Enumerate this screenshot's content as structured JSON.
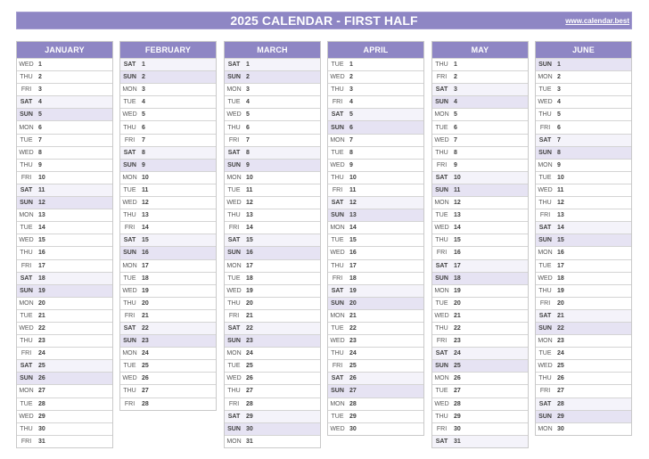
{
  "title": "2025 CALENDAR - FIRST HALF",
  "site_link": "www.calendar.best",
  "colors": {
    "header": "#8e86c4",
    "saturday_row": "#f4f3fa",
    "sunday_row": "#e6e3f3",
    "grid_line": "#d4d4d4"
  },
  "months": [
    {
      "name": "JANUARY",
      "days": [
        {
          "dow": "WED",
          "day": 1
        },
        {
          "dow": "THU",
          "day": 2
        },
        {
          "dow": "FRI",
          "day": 3
        },
        {
          "dow": "SAT",
          "day": 4
        },
        {
          "dow": "SUN",
          "day": 5
        },
        {
          "dow": "MON",
          "day": 6
        },
        {
          "dow": "TUE",
          "day": 7
        },
        {
          "dow": "WED",
          "day": 8
        },
        {
          "dow": "THU",
          "day": 9
        },
        {
          "dow": "FRI",
          "day": 10
        },
        {
          "dow": "SAT",
          "day": 11
        },
        {
          "dow": "SUN",
          "day": 12
        },
        {
          "dow": "MON",
          "day": 13
        },
        {
          "dow": "TUE",
          "day": 14
        },
        {
          "dow": "WED",
          "day": 15
        },
        {
          "dow": "THU",
          "day": 16
        },
        {
          "dow": "FRI",
          "day": 17
        },
        {
          "dow": "SAT",
          "day": 18
        },
        {
          "dow": "SUN",
          "day": 19
        },
        {
          "dow": "MON",
          "day": 20
        },
        {
          "dow": "TUE",
          "day": 21
        },
        {
          "dow": "WED",
          "day": 22
        },
        {
          "dow": "THU",
          "day": 23
        },
        {
          "dow": "FRI",
          "day": 24
        },
        {
          "dow": "SAT",
          "day": 25
        },
        {
          "dow": "SUN",
          "day": 26
        },
        {
          "dow": "MON",
          "day": 27
        },
        {
          "dow": "TUE",
          "day": 28
        },
        {
          "dow": "WED",
          "day": 29
        },
        {
          "dow": "THU",
          "day": 30
        },
        {
          "dow": "FRI",
          "day": 31
        }
      ]
    },
    {
      "name": "FEBRUARY",
      "days": [
        {
          "dow": "SAT",
          "day": 1
        },
        {
          "dow": "SUN",
          "day": 2
        },
        {
          "dow": "MON",
          "day": 3
        },
        {
          "dow": "TUE",
          "day": 4
        },
        {
          "dow": "WED",
          "day": 5
        },
        {
          "dow": "THU",
          "day": 6
        },
        {
          "dow": "FRI",
          "day": 7
        },
        {
          "dow": "SAT",
          "day": 8
        },
        {
          "dow": "SUN",
          "day": 9
        },
        {
          "dow": "MON",
          "day": 10
        },
        {
          "dow": "TUE",
          "day": 11
        },
        {
          "dow": "WED",
          "day": 12
        },
        {
          "dow": "THU",
          "day": 13
        },
        {
          "dow": "FRI",
          "day": 14
        },
        {
          "dow": "SAT",
          "day": 15
        },
        {
          "dow": "SUN",
          "day": 16
        },
        {
          "dow": "MON",
          "day": 17
        },
        {
          "dow": "TUE",
          "day": 18
        },
        {
          "dow": "WED",
          "day": 19
        },
        {
          "dow": "THU",
          "day": 20
        },
        {
          "dow": "FRI",
          "day": 21
        },
        {
          "dow": "SAT",
          "day": 22
        },
        {
          "dow": "SUN",
          "day": 23
        },
        {
          "dow": "MON",
          "day": 24
        },
        {
          "dow": "TUE",
          "day": 25
        },
        {
          "dow": "WED",
          "day": 26
        },
        {
          "dow": "THU",
          "day": 27
        },
        {
          "dow": "FRI",
          "day": 28
        }
      ]
    },
    {
      "name": "MARCH",
      "days": [
        {
          "dow": "SAT",
          "day": 1
        },
        {
          "dow": "SUN",
          "day": 2
        },
        {
          "dow": "MON",
          "day": 3
        },
        {
          "dow": "TUE",
          "day": 4
        },
        {
          "dow": "WED",
          "day": 5
        },
        {
          "dow": "THU",
          "day": 6
        },
        {
          "dow": "FRI",
          "day": 7
        },
        {
          "dow": "SAT",
          "day": 8
        },
        {
          "dow": "SUN",
          "day": 9
        },
        {
          "dow": "MON",
          "day": 10
        },
        {
          "dow": "TUE",
          "day": 11
        },
        {
          "dow": "WED",
          "day": 12
        },
        {
          "dow": "THU",
          "day": 13
        },
        {
          "dow": "FRI",
          "day": 14
        },
        {
          "dow": "SAT",
          "day": 15
        },
        {
          "dow": "SUN",
          "day": 16
        },
        {
          "dow": "MON",
          "day": 17
        },
        {
          "dow": "TUE",
          "day": 18
        },
        {
          "dow": "WED",
          "day": 19
        },
        {
          "dow": "THU",
          "day": 20
        },
        {
          "dow": "FRI",
          "day": 21
        },
        {
          "dow": "SAT",
          "day": 22
        },
        {
          "dow": "SUN",
          "day": 23
        },
        {
          "dow": "MON",
          "day": 24
        },
        {
          "dow": "TUE",
          "day": 25
        },
        {
          "dow": "WED",
          "day": 26
        },
        {
          "dow": "THU",
          "day": 27
        },
        {
          "dow": "FRI",
          "day": 28
        },
        {
          "dow": "SAT",
          "day": 29
        },
        {
          "dow": "SUN",
          "day": 30
        },
        {
          "dow": "MON",
          "day": 31
        }
      ]
    },
    {
      "name": "APRIL",
      "days": [
        {
          "dow": "TUE",
          "day": 1
        },
        {
          "dow": "WED",
          "day": 2
        },
        {
          "dow": "THU",
          "day": 3
        },
        {
          "dow": "FRI",
          "day": 4
        },
        {
          "dow": "SAT",
          "day": 5
        },
        {
          "dow": "SUN",
          "day": 6
        },
        {
          "dow": "MON",
          "day": 7
        },
        {
          "dow": "TUE",
          "day": 8
        },
        {
          "dow": "WED",
          "day": 9
        },
        {
          "dow": "THU",
          "day": 10
        },
        {
          "dow": "FRI",
          "day": 11
        },
        {
          "dow": "SAT",
          "day": 12
        },
        {
          "dow": "SUN",
          "day": 13
        },
        {
          "dow": "MON",
          "day": 14
        },
        {
          "dow": "TUE",
          "day": 15
        },
        {
          "dow": "WED",
          "day": 16
        },
        {
          "dow": "THU",
          "day": 17
        },
        {
          "dow": "FRI",
          "day": 18
        },
        {
          "dow": "SAT",
          "day": 19
        },
        {
          "dow": "SUN",
          "day": 20
        },
        {
          "dow": "MON",
          "day": 21
        },
        {
          "dow": "TUE",
          "day": 22
        },
        {
          "dow": "WED",
          "day": 23
        },
        {
          "dow": "THU",
          "day": 24
        },
        {
          "dow": "FRI",
          "day": 25
        },
        {
          "dow": "SAT",
          "day": 26
        },
        {
          "dow": "SUN",
          "day": 27
        },
        {
          "dow": "MON",
          "day": 28
        },
        {
          "dow": "TUE",
          "day": 29
        },
        {
          "dow": "WED",
          "day": 30
        }
      ]
    },
    {
      "name": "MAY",
      "days": [
        {
          "dow": "THU",
          "day": 1
        },
        {
          "dow": "FRI",
          "day": 2
        },
        {
          "dow": "SAT",
          "day": 3
        },
        {
          "dow": "SUN",
          "day": 4
        },
        {
          "dow": "MON",
          "day": 5
        },
        {
          "dow": "TUE",
          "day": 6
        },
        {
          "dow": "WED",
          "day": 7
        },
        {
          "dow": "THU",
          "day": 8
        },
        {
          "dow": "FRI",
          "day": 9
        },
        {
          "dow": "SAT",
          "day": 10
        },
        {
          "dow": "SUN",
          "day": 11
        },
        {
          "dow": "MON",
          "day": 12
        },
        {
          "dow": "TUE",
          "day": 13
        },
        {
          "dow": "WED",
          "day": 14
        },
        {
          "dow": "THU",
          "day": 15
        },
        {
          "dow": "FRI",
          "day": 16
        },
        {
          "dow": "SAT",
          "day": 17
        },
        {
          "dow": "SUN",
          "day": 18
        },
        {
          "dow": "MON",
          "day": 19
        },
        {
          "dow": "TUE",
          "day": 20
        },
        {
          "dow": "WED",
          "day": 21
        },
        {
          "dow": "THU",
          "day": 22
        },
        {
          "dow": "FRI",
          "day": 23
        },
        {
          "dow": "SAT",
          "day": 24
        },
        {
          "dow": "SUN",
          "day": 25
        },
        {
          "dow": "MON",
          "day": 26
        },
        {
          "dow": "TUE",
          "day": 27
        },
        {
          "dow": "WED",
          "day": 28
        },
        {
          "dow": "THU",
          "day": 29
        },
        {
          "dow": "FRI",
          "day": 30
        },
        {
          "dow": "SAT",
          "day": 31
        }
      ]
    },
    {
      "name": "JUNE",
      "days": [
        {
          "dow": "SUN",
          "day": 1
        },
        {
          "dow": "MON",
          "day": 2
        },
        {
          "dow": "TUE",
          "day": 3
        },
        {
          "dow": "WED",
          "day": 4
        },
        {
          "dow": "THU",
          "day": 5
        },
        {
          "dow": "FRI",
          "day": 6
        },
        {
          "dow": "SAT",
          "day": 7
        },
        {
          "dow": "SUN",
          "day": 8
        },
        {
          "dow": "MON",
          "day": 9
        },
        {
          "dow": "TUE",
          "day": 10
        },
        {
          "dow": "WED",
          "day": 11
        },
        {
          "dow": "THU",
          "day": 12
        },
        {
          "dow": "FRI",
          "day": 13
        },
        {
          "dow": "SAT",
          "day": 14
        },
        {
          "dow": "SUN",
          "day": 15
        },
        {
          "dow": "MON",
          "day": 16
        },
        {
          "dow": "TUE",
          "day": 17
        },
        {
          "dow": "WED",
          "day": 18
        },
        {
          "dow": "THU",
          "day": 19
        },
        {
          "dow": "FRI",
          "day": 20
        },
        {
          "dow": "SAT",
          "day": 21
        },
        {
          "dow": "SUN",
          "day": 22
        },
        {
          "dow": "MON",
          "day": 23
        },
        {
          "dow": "TUE",
          "day": 24
        },
        {
          "dow": "WED",
          "day": 25
        },
        {
          "dow": "THU",
          "day": 26
        },
        {
          "dow": "FRI",
          "day": 27
        },
        {
          "dow": "SAT",
          "day": 28
        },
        {
          "dow": "SUN",
          "day": 29
        },
        {
          "dow": "MON",
          "day": 30
        }
      ]
    }
  ]
}
